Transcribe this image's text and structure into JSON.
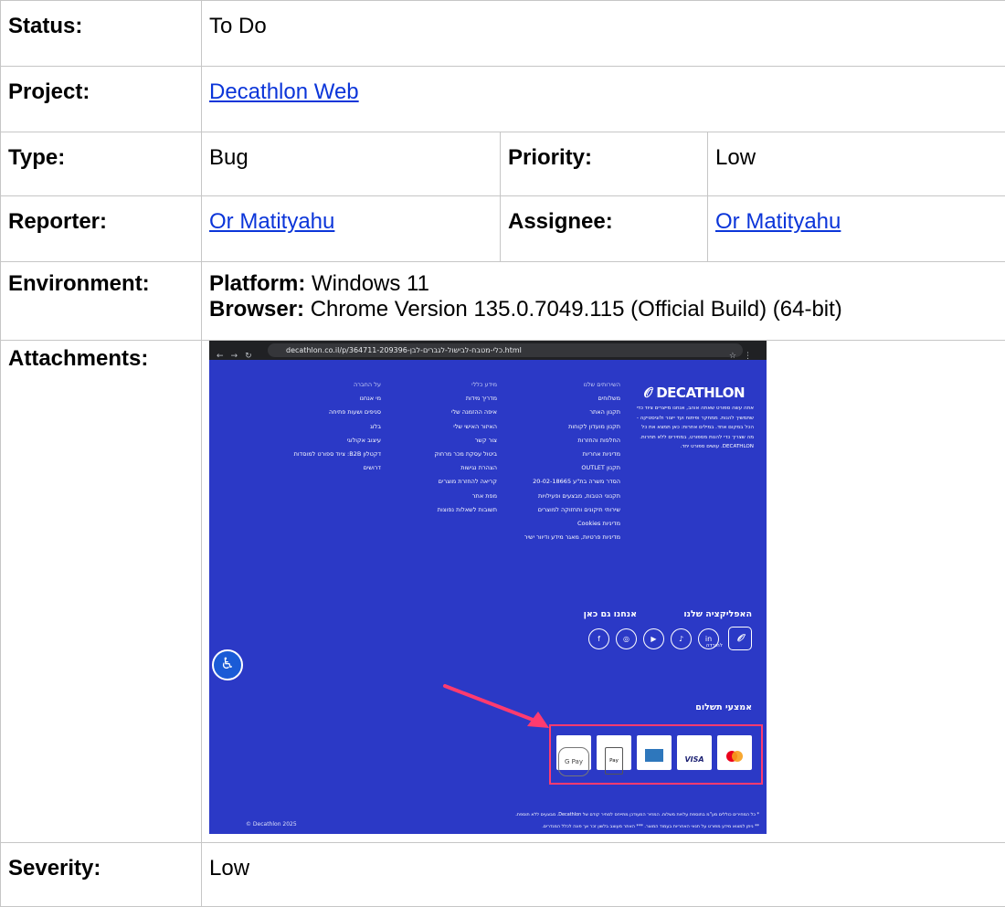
{
  "fields": {
    "status_label": "Status:",
    "status_value": "To Do",
    "project_label": "Project:",
    "project_value": "Decathlon Web",
    "type_label": "Type:",
    "type_value": "Bug",
    "priority_label": "Priority:",
    "priority_value": "Low",
    "reporter_label": "Reporter:",
    "reporter_value": "Or Matityahu",
    "assignee_label": "Assignee:",
    "assignee_value": "Or Matityahu",
    "environment_label": "Environment:",
    "environment_platform_label": "Platform:",
    "environment_platform_value": " Windows 11",
    "environment_browser_label": "Browser:",
    "environment_browser_value": " Chrome Version 135.0.7049.115 (Official Build) (64-bit)",
    "attachments_label": "Attachments:",
    "severity_label": "Severity:",
    "severity_value": "Low"
  },
  "attachment": {
    "url": "decathlon.co.il/p/364711-209396-כלי-מטבח-לבישול-לגברים-לבן.html",
    "logo": "DECATHLON",
    "logo_symbol": "𝒪",
    "about_text": "אתה עשה ספורט שאתה אוהב, אנחנו מייצרים ציוד כדי שתמשיך להנות. ממחקר ופיתוח ועד ייצור ולוגיסטיקה - הכל במקום אחד. במילים אחרות: כאן תמצא את כל מה שצריך כדי להנות מספורט, במחירים ללא תחרות. DECATHLON. עושים ספורט יחד.",
    "col_services": [
      "השירותים שלנו",
      "משלוחים",
      "תקנון האתר",
      "תקנון מועדון לקוחות",
      "החלפות והחזרות",
      "מדיניות אחריות",
      "תקנון OUTLET",
      "הסדר משרה בת\"ע 20-02-18665",
      "תקנוני הטבות, מבצעים ופעילויות",
      "שירותי תיקונים ותחזוקה למוצרים",
      "מדיניות Cookies",
      "מדיניות פרטיות, מאגר מידע ודיוור ישיר"
    ],
    "col_general": [
      "מידע כללי",
      "מדריך מידות",
      "איפה ההזמנה שלי",
      "האיזור האישי שלי",
      "צור קשר",
      "ביטול עסקת מכר מרחוק",
      "הצהרת נגישות",
      "קריאה להחזרת מוצרים",
      "מפת אתר",
      "תשובות לשאלות נפוצות"
    ],
    "col_company": [
      "על החברה",
      "מי אנחנו",
      "סניפים ושעות פתיחה",
      "בלוג",
      "עיצוב אקולוגי",
      "דקטלון B2B: ציוד ספורט למוסדות",
      "דרושים"
    ],
    "app_heading": "האפליקציה שלנו",
    "app_download": "להורדה",
    "social_heading": "אנחנו גם כאן",
    "social_icons": [
      "in",
      "♪",
      "▶",
      "◎",
      "f"
    ],
    "payment_heading": "אמצעי תשלום",
    "payment_methods": [
      "G Pay",
      "Pay",
      "",
      "VISA",
      ""
    ],
    "footnote_1": "* כל המחירים כוללים מע\"מ בתוספת עלויות משלוח. המחיר המעודכן מתייחס למחיר קודם של Decathlon. מבצעים ללא תוספת.",
    "footnote_2": "** ניתן למצוא מידע מפורט על תנאי האחריות בעמוד המוצר. *** האתר מעוצב בלשון זכר אך פונה לכלל המגדרים.",
    "copyright": "© Decathlon 2025",
    "accessibility_symbol": "♿"
  }
}
